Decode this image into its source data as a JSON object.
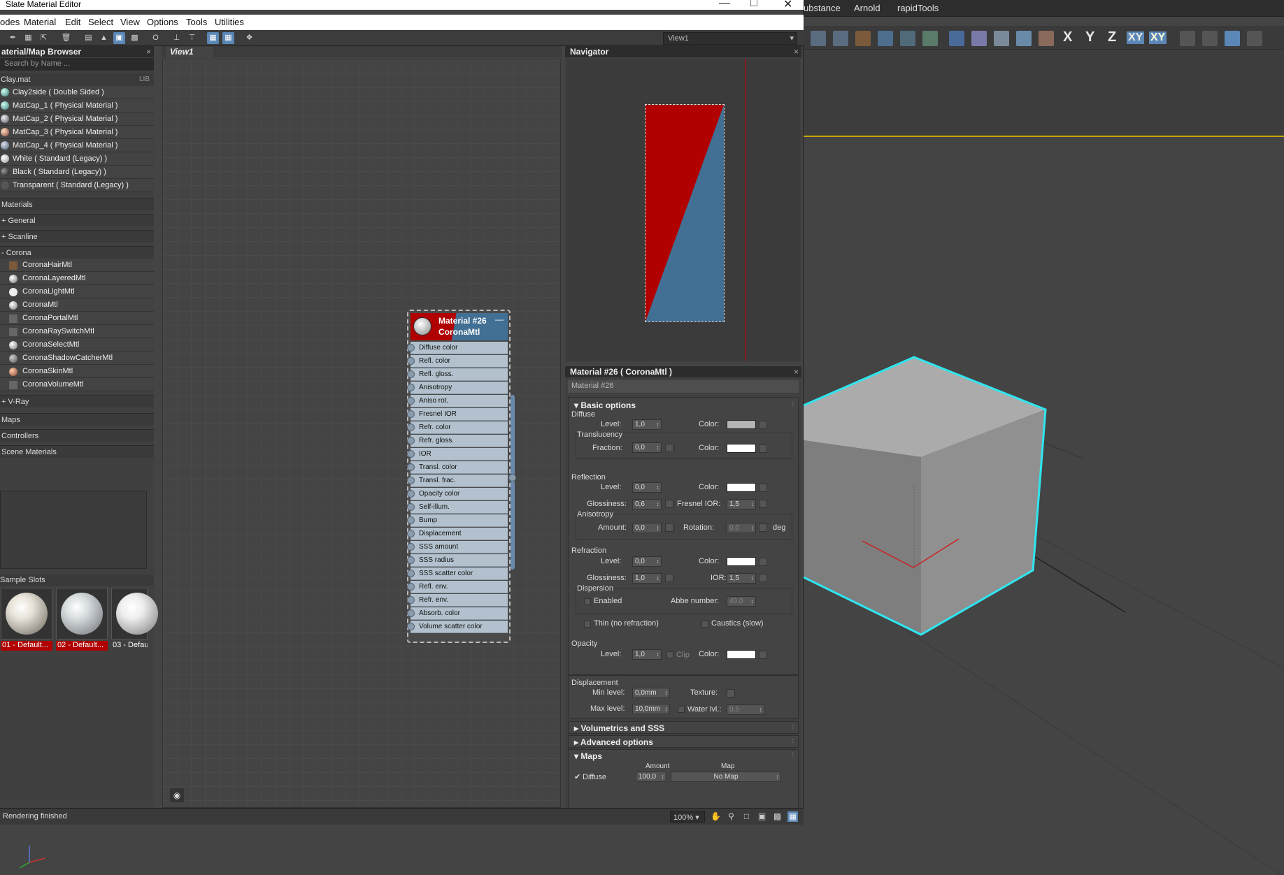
{
  "window": {
    "title": "Slate Material Editor"
  },
  "menu": [
    "odes",
    "Material",
    "Edit",
    "Select",
    "View",
    "Options",
    "Tools",
    "Utilities"
  ],
  "max_menu": [
    "ubstance",
    "Arnold",
    "rapidTools"
  ],
  "max_axes": [
    "X",
    "Y",
    "Z",
    "XY",
    "XY"
  ],
  "view_select": "View1",
  "browser": {
    "title": "aterial/Map Browser",
    "search_placeholder": "Search by Name ...",
    "library": {
      "name": "Clay.mat",
      "tag": "LIB"
    },
    "library_items": [
      "Clay2side  ( Double Sided )",
      "MatCap_1  ( Physical Material )",
      "MatCap_2  ( Physical Material )",
      "MatCap_3  ( Physical Material )",
      "MatCap_4  ( Physical Material )",
      "White  ( Standard (Legacy) )",
      "Black  ( Standard (Legacy) )",
      "Transparent  ( Standard (Legacy) )"
    ],
    "materials_label": "Materials",
    "groups": [
      "+ General",
      "+ Scanline",
      "- Corona"
    ],
    "corona_items": [
      "CoronaHairMtl",
      "CoronaLayeredMtl",
      "CoronaLightMtl",
      "CoronaMtl",
      "CoronaPortalMtl",
      "CoronaRaySwitchMtl",
      "CoronaSelectMtl",
      "CoronaShadowCatcherMtl",
      "CoronaSkinMtl",
      "CoronaVolumeMtl"
    ],
    "vray_group": "+ V-Ray",
    "maps_label": "Maps",
    "controllers_label": "Controllers",
    "scene_label": "Scene Materials",
    "sample_slots_label": "Sample Slots",
    "sample_slots": [
      "01 - Default...",
      "02 - Default...",
      "03 - Defau"
    ]
  },
  "view1": {
    "tab": "View1"
  },
  "node": {
    "name": "Material #26",
    "type": "CoronaMtl",
    "slots": [
      "Diffuse color",
      "Refl. color",
      "Refl. gloss.",
      "Anisotropy",
      "Aniso rot.",
      "Fresnel IOR",
      "Refr. color",
      "Refr. gloss.",
      "IOR",
      "Transl. color",
      "Transl. frac.",
      "Opacity color",
      "Self-illum.",
      "Bump",
      "Displacement",
      "SSS amount",
      "SSS radius",
      "SSS scatter color",
      "Refl. env.",
      "Refr. env.",
      "Absorb. color",
      "Volume scatter color"
    ]
  },
  "navigator": {
    "title": "Navigator"
  },
  "params": {
    "title": "Material #26  ( CoronaMtl )",
    "name_field": "Material #26",
    "basic_options": "Basic options",
    "diffuse": {
      "label": "Diffuse",
      "level_label": "Level:",
      "level": "1,0",
      "color_label": "Color:",
      "color": "#b4b4b4"
    },
    "translucency": {
      "label": "Translucency",
      "fraction_label": "Fraction:",
      "fraction": "0,0",
      "color_label": "Color:",
      "color": "#ffffff"
    },
    "reflection": {
      "label": "Reflection",
      "level_label": "Level:",
      "level": "0,0",
      "color_label": "Color:",
      "color": "#ffffff",
      "gloss_label": "Glossiness:",
      "gloss": "0,6",
      "fresnel_label": "Fresnel IOR:",
      "fresnel": "1,5"
    },
    "anisotropy": {
      "label": "Anisotropy",
      "amount_label": "Amount:",
      "amount": "0,0",
      "rotation_label": "Rotation:",
      "rotation": "0,0",
      "unit": "deg"
    },
    "refraction": {
      "label": "Refraction",
      "level_label": "Level:",
      "level": "0,0",
      "color_label": "Color:",
      "color": "#ffffff",
      "gloss_label": "Glossiness:",
      "gloss": "1,0",
      "ior_label": "IOR:",
      "ior": "1,5"
    },
    "dispersion": {
      "label": "Dispersion",
      "enabled_label": "Enabled",
      "abbe_label": "Abbe number:",
      "abbe": "40,0"
    },
    "thin_label": "Thin (no refraction)",
    "caustics_label": "Caustics (slow)",
    "opacity": {
      "label": "Opacity",
      "level_label": "Level:",
      "level": "1,0",
      "clip_label": "Clip",
      "color_label": "Color:",
      "color": "#ffffff"
    },
    "displacement": {
      "label": "Displacement",
      "min_label": "Min level:",
      "min": "0,0mm",
      "texture_label": "Texture:",
      "max_label": "Max level:",
      "max": "10,0mm",
      "water_label": "Water lvl.:",
      "water": "0,5"
    },
    "volumetrics": "Volumetrics and SSS",
    "advanced": "Advanced options",
    "maps": "Maps",
    "maps_amount_header": "Amount",
    "maps_map_header": "Map",
    "maps_diffuse_label": "Diffuse",
    "maps_diffuse_amount": "100,0",
    "maps_diffuse_map": "No Map"
  },
  "status": {
    "text": "Rendering finished",
    "zoom": "100%"
  },
  "colors": {
    "accent_blue": "#5a87b5",
    "node_red": "#b00000",
    "node_blue": "#426f94",
    "selection_cyan": "#2ee6f0",
    "viewport_border": "#c8a400"
  }
}
